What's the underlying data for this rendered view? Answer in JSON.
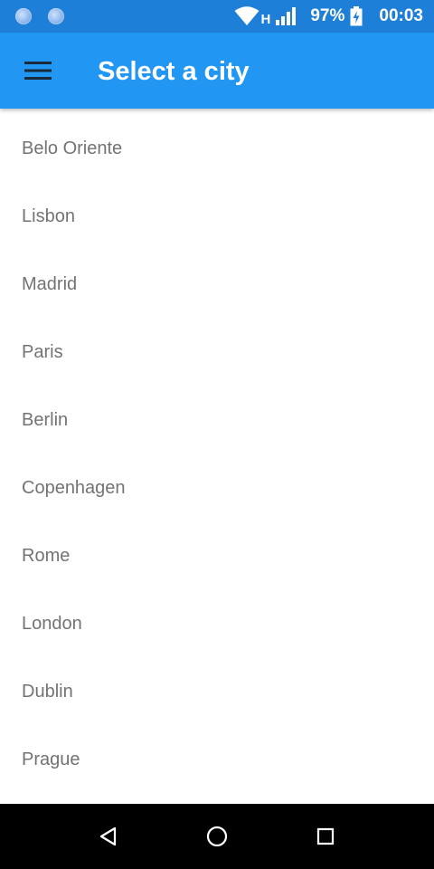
{
  "status_bar": {
    "network_type": "H",
    "battery_percent": "97%",
    "time": "00:03"
  },
  "app_bar": {
    "title": "Select a city",
    "menu_icon": "hamburger-menu-icon"
  },
  "cities": [
    "Belo Oriente",
    "Lisbon",
    "Madrid",
    "Paris",
    "Berlin",
    "Copenhagen",
    "Rome",
    "London",
    "Dublin",
    "Prague"
  ],
  "nav_bar": {
    "back_icon": "back-triangle-icon",
    "home_icon": "home-circle-icon",
    "recents_icon": "recents-square-icon"
  },
  "colors": {
    "status_bar": "#1e7fd8",
    "app_bar": "#2196f3",
    "list_text": "#737373",
    "nav_bar": "#000000"
  }
}
